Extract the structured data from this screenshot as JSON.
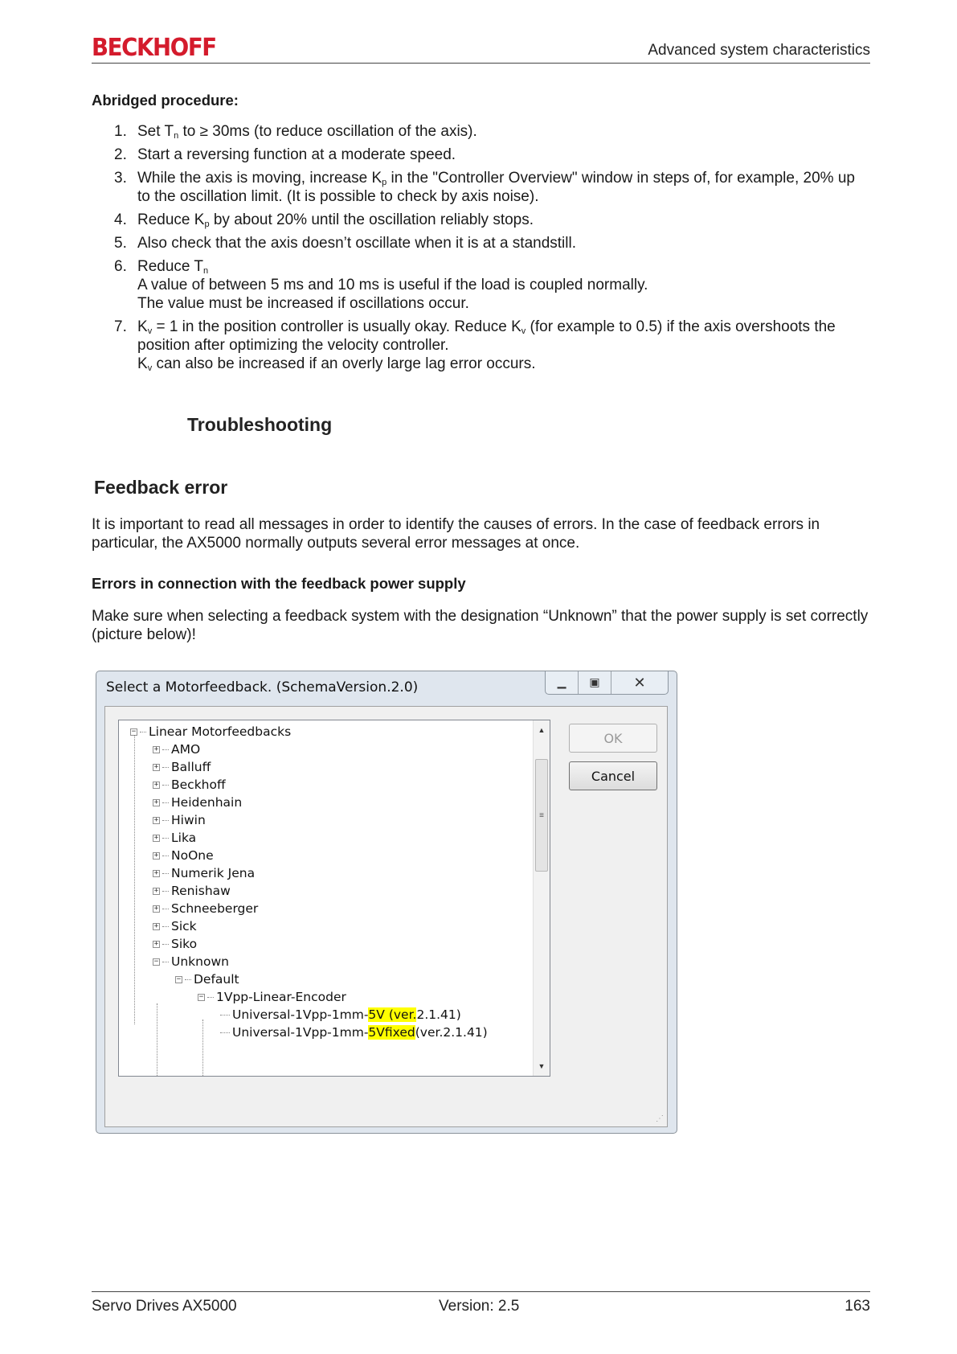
{
  "header": {
    "logo": "BECKHOFF",
    "section": "Advanced system characteristics"
  },
  "procedure": {
    "heading": "Abridged procedure:",
    "steps": [
      {
        "num": "1.",
        "pre": "Set T",
        "sub": "n",
        "post": " to ≥ 30ms (to reduce oscillation of the axis)."
      },
      {
        "num": "2.",
        "text": "Start a reversing function at a moderate speed."
      },
      {
        "num": "3.",
        "pre": "While the axis is moving, increase K",
        "sub": "p",
        "post": " in the \"Controller Overview\" window in steps of, for example, 20% up to the oscillation limit. (It is possible to check by axis noise)."
      },
      {
        "num": "4.",
        "pre": "Reduce K",
        "sub": "p",
        "post": " by about 20% until the oscillation reliably stops."
      },
      {
        "num": "5.",
        "text": "Also check that the axis doesn’t oscillate when it is at a standstill."
      },
      {
        "num": "6.",
        "pre": "Reduce T",
        "sub": "n",
        "line2": "A value of between 5 ms and 10 ms is useful if the load is coupled normally.",
        "line3": "The value must be increased if oscillations occur."
      },
      {
        "num": "7.",
        "pre": "K",
        "sub": "v",
        "mid": " = 1 in the position controller is usually okay. Reduce K",
        "sub2": "v",
        "post": " (for example to 0.5) if the axis overshoots the position after optimizing the velocity controller.",
        "line3pre": "K",
        "line3sub": "v",
        "line3post": " can also be increased if an overly large lag error occurs."
      }
    ]
  },
  "troubleshooting": {
    "heading": "Troubleshooting"
  },
  "feedback": {
    "heading": "Feedback error",
    "intro": "It is important to read all messages in order to identify the causes of errors. In the case of feedback errors in particular, the AX5000 normally outputs several error messages at once.",
    "subheading": "Errors in connection with the feedback power supply",
    "para": "Make sure when selecting a feedback system with the designation “Unknown” that the power supply is set correctly (picture below)!"
  },
  "dialog": {
    "title": "Select a Motorfeedback. (SchemaVersion.2.0)",
    "ok_label": "OK",
    "cancel_label": "Cancel",
    "tree": {
      "root": "Linear Motorfeedbacks",
      "vendors": [
        "AMO",
        "Balluff",
        "Beckhoff",
        "Heidenhain",
        "Hiwin",
        "Lika",
        "NoOne",
        "Numerik Jena",
        "Renishaw",
        "Schneeberger",
        "Sick",
        "Siko",
        "Unknown"
      ],
      "default_node": "Default",
      "encoder_node": "1Vpp-Linear-Encoder",
      "leaf1": {
        "a": "Universal-1Vpp-1mm-",
        "hl": "5V (ver.",
        "b": "2.1.41)"
      },
      "leaf2": {
        "a": "Universal-1Vpp-1mm-",
        "hl": "5Vfixed",
        "b": " (ver.2.1.41)"
      }
    }
  },
  "footer": {
    "left": "Servo Drives AX5000",
    "center": "Version: 2.5",
    "page": "163"
  }
}
